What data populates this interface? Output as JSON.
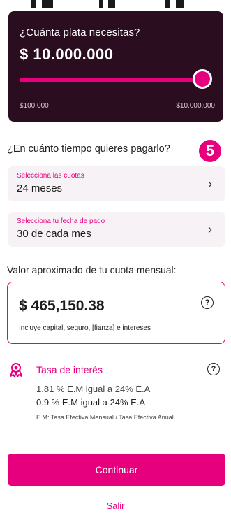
{
  "amount_card": {
    "question": "¿Cuánta plata necesitas?",
    "amount": "$ 10.000.000",
    "min_label": "$100.000",
    "max_label": "$10.000.000",
    "slider_fraction": 1.0
  },
  "term": {
    "question": "¿En cuánto tiempo quieres pagarlo?",
    "step_badge": "5"
  },
  "installments": {
    "label": "Selecciona las cuotas",
    "value": "24 meses"
  },
  "payment_date": {
    "label": "Selecciona tu fecha de pago",
    "value": "30 de cada mes"
  },
  "monthly": {
    "question": "Valor aproximado de tu cuota mensual:",
    "amount": "$ 465,150.38",
    "note": "Incluye capital, seguro, [fianza] e intereses",
    "help": "?"
  },
  "rate": {
    "title": "Tasa de interés",
    "old": "1.81 % E.M igual a 24% E.A",
    "new": "0.9 % E.M igual a 24% E.A",
    "definition": "E.M: Tasa Efectiva Mensual / Tasa Efectiva Anual",
    "help": "?"
  },
  "actions": {
    "continue": "Continuar",
    "exit": "Salir"
  },
  "colors": {
    "accent": "#e6007e",
    "card_bg": "#2a0e1f",
    "row_bg": "#f7f2f5"
  }
}
